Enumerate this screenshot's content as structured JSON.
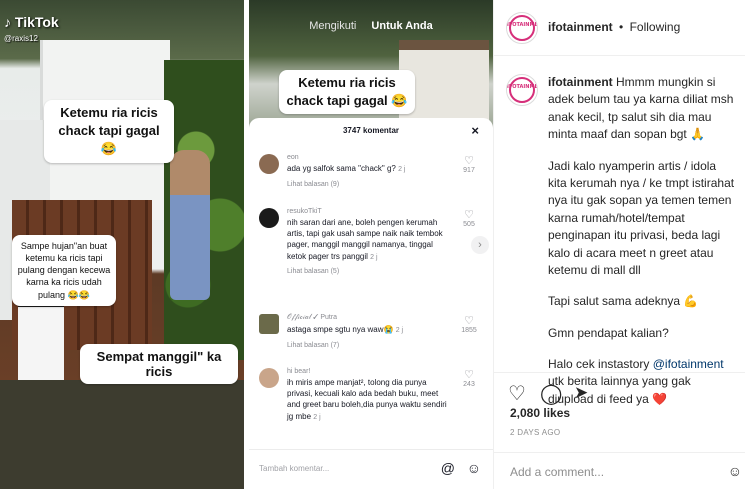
{
  "left_video": {
    "app_label": "TikTok",
    "username": "@raxis12",
    "caption_top": "Ketemu ria ricis chack tapi gagal 😂",
    "caption_middle": "Sampe hujan\"an buat ketemu ka ricis tapi pulang dengan kecewa karna ka ricis udah pulang 😂😂",
    "caption_bottom": "Sempat manggil\" ka ricis"
  },
  "right_video": {
    "tab_following": "Mengikuti",
    "tab_for_you": "Untuk Anda",
    "caption_top": "Ketemu ria ricis chack tapi gagal 😂",
    "comments_sheet": {
      "count_label": "3747 komentar",
      "close_icon": "×",
      "comments": [
        {
          "user": "eon",
          "text": "ada yg salfok sama \"chack\" g?",
          "date": "2 j",
          "likes": "917",
          "replies": "Lihat balasan (9)",
          "avatar_color": "#8a6a52"
        },
        {
          "user": "resukoTkiT",
          "text": "nih saran dari ane, boleh pengen kerumah artis, tapi gak usah sampe naik naik tembok pager, manggil manggil namanya, tinggal ketok pager trs panggil",
          "date": "2 j",
          "likes": "505",
          "replies": "Lihat balasan (5)",
          "avatar_color": "#1a1a1a"
        },
        {
          "user": "𝒪𝒻𝒻𝒾𝒸𝒾𝒶𝓁 ✓ Putra",
          "text": "astaga smpe sgtu nya waw😭",
          "date": "2 j",
          "likes": "1855",
          "replies": "Lihat balasan (7)",
          "avatar_color": "#6b6a4a"
        },
        {
          "user": "hi bear!",
          "text": "ih miris ampe manjat², tolong dia punya privasi, kecuali kalo ada bedah buku, meet and greet baru boleh,dia punya waktu sendiri jg mbe",
          "date": "2 j",
          "likes": "243",
          "replies": "",
          "avatar_color": "#c9a58a"
        }
      ],
      "input_placeholder": "Tambah komentar...",
      "at_icon": "@",
      "emoji_icon": "☺",
      "next_arrow": "›"
    }
  },
  "instagram": {
    "account": "ifotainment",
    "separator": "•",
    "follow_status": "Following",
    "avatar_text": "IFOTAINMENT",
    "caption": {
      "user": "ifotainment",
      "para1": "Hmmm mungkin si adek belum tau ya karna diliat msh anak kecil, tp salut sih dia mau minta maaf dan sopan bgt 🙏",
      "para2": "Jadi kalo nyamperin artis / idola kita kerumah nya / ke tmpt istirahat nya itu gak sopan ya temen temen karna rumah/hotel/tempat penginapan itu privasi, beda lagi kalo di acara meet n greet atau ketemu di mall dll",
      "para3": "Tapi salut sama adeknya 💪",
      "para4": "Gmn pendapat kalian?",
      "para5_prefix": "Halo cek instastory ",
      "para5_mention": "@ifotainment",
      "para5_suffix": " utk berita lainnya yang gak diupload di feed ya ❤️"
    },
    "actions": {
      "like_icon": "♡",
      "comment_icon": "◯",
      "share_icon": "➤"
    },
    "likes": "2,080 likes",
    "time_ago": "2 DAYS AGO",
    "add_comment_placeholder": "Add a comment...",
    "emoji_icon": "☺",
    "accent_color": "#00376b",
    "brand_pink": "#d62f7a"
  }
}
